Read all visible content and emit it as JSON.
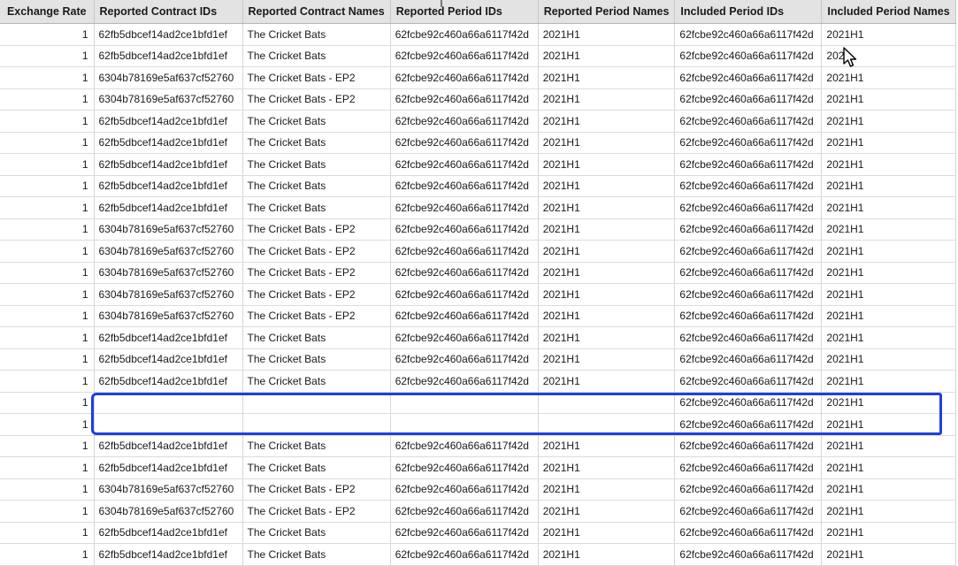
{
  "headers": [
    "Exchange Rate",
    "Reported Contract IDs",
    "Reported Contract Names",
    "Reported Period IDs",
    "Reported Period Names",
    "Included Period IDs",
    "Included Period Names"
  ],
  "rows": [
    [
      "1",
      "62fb5dbcef14ad2ce1bfd1ef",
      "The Cricket Bats",
      "62fcbe92c460a66a6117f42d",
      "2021H1",
      "62fcbe92c460a66a6117f42d",
      "2021H1"
    ],
    [
      "1",
      "62fb5dbcef14ad2ce1bfd1ef",
      "The Cricket Bats",
      "62fcbe92c460a66a6117f42d",
      "2021H1",
      "62fcbe92c460a66a6117f42d",
      "2021"
    ],
    [
      "1",
      "6304b78169e5af637cf52760",
      "The Cricket Bats - EP2",
      "62fcbe92c460a66a6117f42d",
      "2021H1",
      "62fcbe92c460a66a6117f42d",
      "2021H1"
    ],
    [
      "1",
      "6304b78169e5af637cf52760",
      "The Cricket Bats - EP2",
      "62fcbe92c460a66a6117f42d",
      "2021H1",
      "62fcbe92c460a66a6117f42d",
      "2021H1"
    ],
    [
      "1",
      "62fb5dbcef14ad2ce1bfd1ef",
      "The Cricket Bats",
      "62fcbe92c460a66a6117f42d",
      "2021H1",
      "62fcbe92c460a66a6117f42d",
      "2021H1"
    ],
    [
      "1",
      "62fb5dbcef14ad2ce1bfd1ef",
      "The Cricket Bats",
      "62fcbe92c460a66a6117f42d",
      "2021H1",
      "62fcbe92c460a66a6117f42d",
      "2021H1"
    ],
    [
      "1",
      "62fb5dbcef14ad2ce1bfd1ef",
      "The Cricket Bats",
      "62fcbe92c460a66a6117f42d",
      "2021H1",
      "62fcbe92c460a66a6117f42d",
      "2021H1"
    ],
    [
      "1",
      "62fb5dbcef14ad2ce1bfd1ef",
      "The Cricket Bats",
      "62fcbe92c460a66a6117f42d",
      "2021H1",
      "62fcbe92c460a66a6117f42d",
      "2021H1"
    ],
    [
      "1",
      "62fb5dbcef14ad2ce1bfd1ef",
      "The Cricket Bats",
      "62fcbe92c460a66a6117f42d",
      "2021H1",
      "62fcbe92c460a66a6117f42d",
      "2021H1"
    ],
    [
      "1",
      "6304b78169e5af637cf52760",
      "The Cricket Bats - EP2",
      "62fcbe92c460a66a6117f42d",
      "2021H1",
      "62fcbe92c460a66a6117f42d",
      "2021H1"
    ],
    [
      "1",
      "6304b78169e5af637cf52760",
      "The Cricket Bats - EP2",
      "62fcbe92c460a66a6117f42d",
      "2021H1",
      "62fcbe92c460a66a6117f42d",
      "2021H1"
    ],
    [
      "1",
      "6304b78169e5af637cf52760",
      "The Cricket Bats - EP2",
      "62fcbe92c460a66a6117f42d",
      "2021H1",
      "62fcbe92c460a66a6117f42d",
      "2021H1"
    ],
    [
      "1",
      "6304b78169e5af637cf52760",
      "The Cricket Bats - EP2",
      "62fcbe92c460a66a6117f42d",
      "2021H1",
      "62fcbe92c460a66a6117f42d",
      "2021H1"
    ],
    [
      "1",
      "6304b78169e5af637cf52760",
      "The Cricket Bats - EP2",
      "62fcbe92c460a66a6117f42d",
      "2021H1",
      "62fcbe92c460a66a6117f42d",
      "2021H1"
    ],
    [
      "1",
      "62fb5dbcef14ad2ce1bfd1ef",
      "The Cricket Bats",
      "62fcbe92c460a66a6117f42d",
      "2021H1",
      "62fcbe92c460a66a6117f42d",
      "2021H1"
    ],
    [
      "1",
      "62fb5dbcef14ad2ce1bfd1ef",
      "The Cricket Bats",
      "62fcbe92c460a66a6117f42d",
      "2021H1",
      "62fcbe92c460a66a6117f42d",
      "2021H1"
    ],
    [
      "1",
      "62fb5dbcef14ad2ce1bfd1ef",
      "The Cricket Bats",
      "62fcbe92c460a66a6117f42d",
      "2021H1",
      "62fcbe92c460a66a6117f42d",
      "2021H1"
    ],
    [
      "1",
      "",
      "",
      "",
      "",
      "62fcbe92c460a66a6117f42d",
      "2021H1"
    ],
    [
      "1",
      "",
      "",
      "",
      "",
      "62fcbe92c460a66a6117f42d",
      "2021H1"
    ],
    [
      "1",
      "62fb5dbcef14ad2ce1bfd1ef",
      "The Cricket Bats",
      "62fcbe92c460a66a6117f42d",
      "2021H1",
      "62fcbe92c460a66a6117f42d",
      "2021H1"
    ],
    [
      "1",
      "62fb5dbcef14ad2ce1bfd1ef",
      "The Cricket Bats",
      "62fcbe92c460a66a6117f42d",
      "2021H1",
      "62fcbe92c460a66a6117f42d",
      "2021H1"
    ],
    [
      "1",
      "6304b78169e5af637cf52760",
      "The Cricket Bats - EP2",
      "62fcbe92c460a66a6117f42d",
      "2021H1",
      "62fcbe92c460a66a6117f42d",
      "2021H1"
    ],
    [
      "1",
      "6304b78169e5af637cf52760",
      "The Cricket Bats - EP2",
      "62fcbe92c460a66a6117f42d",
      "2021H1",
      "62fcbe92c460a66a6117f42d",
      "2021H1"
    ],
    [
      "1",
      "62fb5dbcef14ad2ce1bfd1ef",
      "The Cricket Bats",
      "62fcbe92c460a66a6117f42d",
      "2021H1",
      "62fcbe92c460a66a6117f42d",
      "2021H1"
    ],
    [
      "1",
      "62fb5dbcef14ad2ce1bfd1ef",
      "The Cricket Bats",
      "62fcbe92c460a66a6117f42d",
      "2021H1",
      "62fcbe92c460a66a6117f42d",
      "2021H1"
    ]
  ],
  "highlight_color": "#1f3fe0",
  "cursor_icon": "mouse-pointer-icon"
}
